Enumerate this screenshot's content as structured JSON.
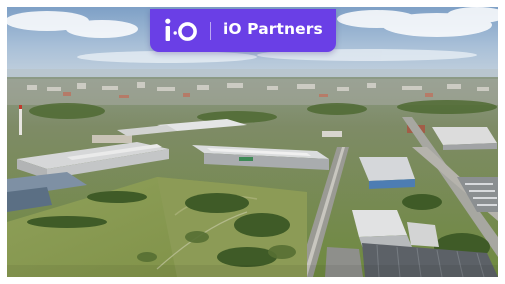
{
  "brand": {
    "name": "iO Partners",
    "logo_icon": "io-monogram-icon",
    "bar_color": "#6a3fe6"
  },
  "photo": {
    "icon": "aerial-industrial-park-photo"
  }
}
